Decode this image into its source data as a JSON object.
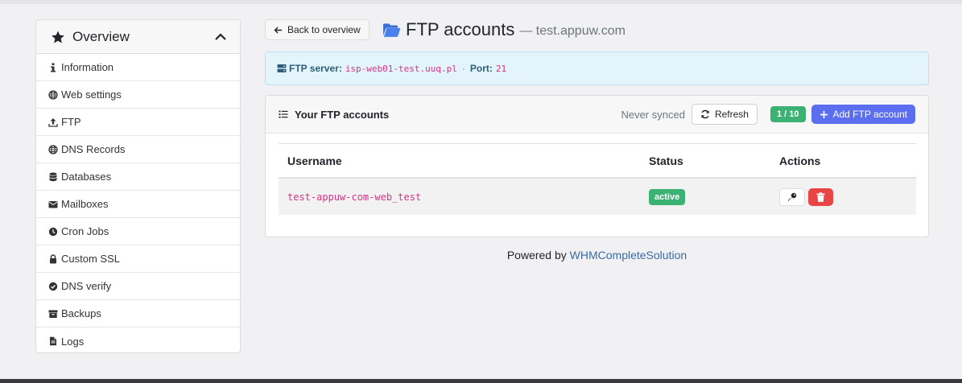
{
  "sidebar": {
    "title": "Overview",
    "items": [
      {
        "label": "Information",
        "icon": "info-icon"
      },
      {
        "label": "Web settings",
        "icon": "globe-icon"
      },
      {
        "label": "FTP",
        "icon": "upload-icon"
      },
      {
        "label": "DNS Records",
        "icon": "globe-icon"
      },
      {
        "label": "Databases",
        "icon": "database-icon"
      },
      {
        "label": "Mailboxes",
        "icon": "envelope-icon"
      },
      {
        "label": "Cron Jobs",
        "icon": "clock-icon"
      },
      {
        "label": "Custom SSL",
        "icon": "lock-icon"
      },
      {
        "label": "DNS verify",
        "icon": "check-circle-icon"
      },
      {
        "label": "Backups",
        "icon": "archive-icon"
      },
      {
        "label": "Logs",
        "icon": "file-icon"
      }
    ]
  },
  "header": {
    "back_label": "Back to overview",
    "title": "FTP accounts",
    "subtitle": "— test.appuw.com"
  },
  "info": {
    "server_label": "FTP server:",
    "server_value": "isp-web01-test.uuq.pl",
    "separator": "·",
    "port_label": "Port:",
    "port_value": "21"
  },
  "panel": {
    "title": "Your FTP accounts",
    "sync_status": "Never synced",
    "refresh_label": "Refresh",
    "count": "1 / 10",
    "add_label": "Add FTP account"
  },
  "table": {
    "columns": [
      "Username",
      "Status",
      "Actions"
    ],
    "rows": [
      {
        "username": "test-appuw-com-web_test",
        "status": "active"
      }
    ]
  },
  "footer": {
    "prefix": "Powered by",
    "link": "WHMCompleteSolution"
  },
  "colors": {
    "accent": "#5b6ef0",
    "success": "#3bb273",
    "danger": "#e84646",
    "info_bg": "#e3f4fb",
    "code": "#d63384"
  }
}
